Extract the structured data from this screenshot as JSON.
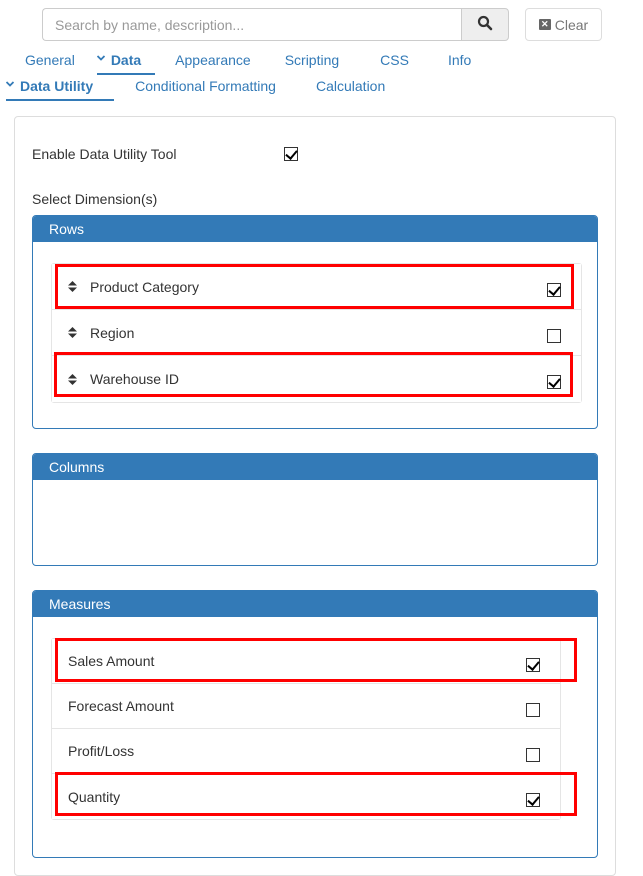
{
  "search": {
    "placeholder": "Search by name, description...",
    "value": "",
    "search_icon": "search-icon",
    "clear_label": "Clear",
    "clear_icon": "close-box-icon"
  },
  "tabs": [
    {
      "label": "General",
      "active": false
    },
    {
      "label": "Data",
      "active": true,
      "expanded": true
    },
    {
      "label": "Appearance",
      "active": false
    },
    {
      "label": "Scripting",
      "active": false
    },
    {
      "label": "CSS",
      "active": false
    },
    {
      "label": "Info",
      "active": false
    }
  ],
  "subtabs": [
    {
      "label": "Data Utility",
      "active": true,
      "expanded": true
    },
    {
      "label": "Conditional Formatting",
      "active": false
    },
    {
      "label": "Calculation",
      "active": false
    }
  ],
  "form": {
    "enable_label": "Enable Data Utility Tool",
    "enable_checked": true,
    "select_dimensions_label": "Select Dimension(s)"
  },
  "rows_panel": {
    "title": "Rows",
    "items": [
      {
        "label": "Product Category",
        "checked": true,
        "highlighted": true
      },
      {
        "label": "Region",
        "checked": false,
        "highlighted": false
      },
      {
        "label": "Warehouse ID",
        "checked": true,
        "highlighted": true
      }
    ]
  },
  "columns_panel": {
    "title": "Columns",
    "items": []
  },
  "measures_panel": {
    "title": "Measures",
    "items": [
      {
        "label": "Sales Amount",
        "checked": true,
        "highlighted": true
      },
      {
        "label": "Forecast Amount",
        "checked": false,
        "highlighted": false
      },
      {
        "label": "Profit/Loss",
        "checked": false,
        "highlighted": false
      },
      {
        "label": "Quantity",
        "checked": true,
        "highlighted": true
      }
    ]
  },
  "colors": {
    "accent": "#337ab7",
    "highlight": "#ff0000",
    "border": "#dddddd"
  }
}
